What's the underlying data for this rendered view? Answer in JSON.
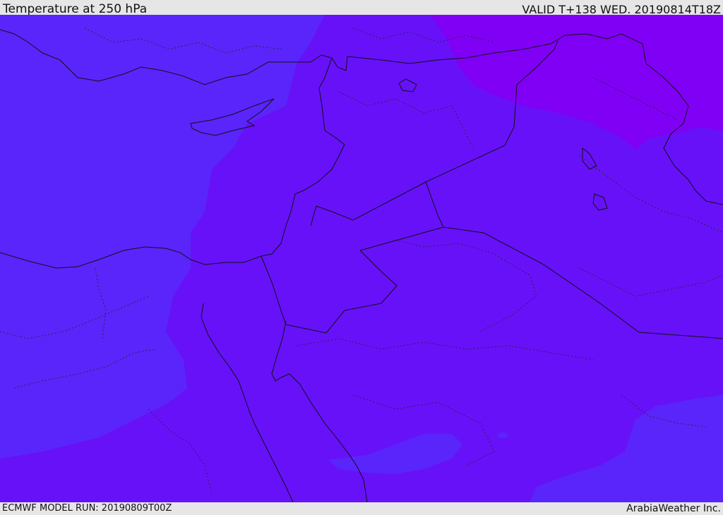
{
  "header": {
    "title": "Temperature at 250 hPa",
    "valid": "VALID T+138 WED. 20190814T18Z"
  },
  "footer": {
    "model_run": "ECMWF MODEL RUN: 20190809T00Z",
    "credit": "ArabiaWeather Inc."
  },
  "colors": {
    "cooler": "#8000f5",
    "mid": "#6711f9",
    "warmer": "#5a25fa",
    "border": "#111111"
  }
}
